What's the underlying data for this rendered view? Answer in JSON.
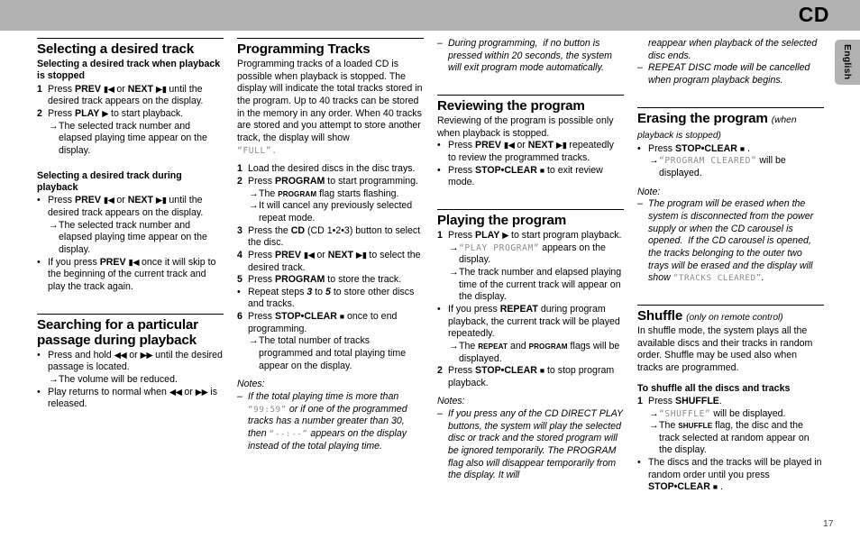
{
  "header": {
    "title": "CD",
    "language_tab": "English"
  },
  "page_number": "17",
  "columns": [
    {
      "id": "col-1",
      "blocks": [
        {
          "type": "rule"
        },
        {
          "type": "title",
          "text": "Selecting a desired track"
        },
        {
          "type": "subtitle",
          "text": "Selecting a desired track when playback is stopped"
        },
        {
          "type": "numrow",
          "marker": "1",
          "html": "Press <b>PREV</b> <span class=\"gly\">&#9646;&#9664;</span> or <b>NEXT</b> <span class=\"gly\">&#9654;&#9646;</span> until the desired track appears on the display."
        },
        {
          "type": "numrow",
          "marker": "2",
          "html": "Press <b>PLAY</b> <span class=\"gly\">&#9654;</span> to start playback."
        },
        {
          "type": "arrow",
          "html": "The selected track number and elapsed playing time appear on the display."
        },
        {
          "type": "spacer-md"
        },
        {
          "type": "subtitle",
          "text": "Selecting a desired track during playback"
        },
        {
          "type": "bullet",
          "html": "Press <b>PREV</b> <span class=\"gly\">&#9646;&#9664;</span> or <b>NEXT</b> <span class=\"gly\">&#9654;&#9646;</span> until the desired track appears on the display."
        },
        {
          "type": "arrow",
          "html": "The selected track number and elapsed playing time appear on the display."
        },
        {
          "type": "bullet",
          "html": "If you press <b>PREV</b> <span class=\"gly\">&#9646;&#9664;</span> once it will skip to the beginning of the current track and play the track again."
        },
        {
          "type": "spacer-lg"
        },
        {
          "type": "rule"
        },
        {
          "type": "title",
          "text": "Searching for a particular passage during playback"
        },
        {
          "type": "bullet",
          "html": "Press and hold <span class=\"gly\">&#9664;&#9664;</span> or <span class=\"gly\">&#9654;&#9654;</span> until the desired passage is located."
        },
        {
          "type": "arrow",
          "html": "The volume will be reduced."
        },
        {
          "type": "bullet",
          "html": "Play returns to normal when <span class=\"gly\">&#9664;&#9664;</span> or <span class=\"gly\">&#9654;&#9654;</span> is released."
        }
      ]
    },
    {
      "id": "col-2",
      "blocks": [
        {
          "type": "rule"
        },
        {
          "type": "title",
          "text": "Programming Tracks"
        },
        {
          "type": "para",
          "text": "Programming tracks of a loaded CD is possible when playback is stopped. The display will indicate the total tracks stored in the program. Up to 40 tracks can be stored in the memory in any order. When 40 tracks are stored and you attempt to store another track, the display will show"
        },
        {
          "type": "para-lcd",
          "pre": "",
          "lcd": "“FULL”.",
          "post": ""
        },
        {
          "type": "spacer-sm"
        },
        {
          "type": "numrow",
          "marker": "1",
          "html": "Load the desired discs in the disc trays."
        },
        {
          "type": "numrow",
          "marker": "2",
          "html": "Press <b>PROGRAM</b> to start programming."
        },
        {
          "type": "arrow",
          "html": "The <span class=\"flag\">PROGRAM</span> flag starts flashing."
        },
        {
          "type": "arrow",
          "html": "It will cancel any previously selected repeat mode."
        },
        {
          "type": "numrow",
          "marker": "3",
          "html": "Press the <b>CD</b> (CD 1&#8226;2&#8226;3) button to select the disc."
        },
        {
          "type": "numrow",
          "marker": "4",
          "html": "Press <b>PREV</b> <span class=\"gly\">&#9646;&#9664;</span> or <b>NEXT</b> <span class=\"gly\">&#9654;&#9646;</span> to select the desired track."
        },
        {
          "type": "numrow",
          "marker": "5",
          "html": "Press <b>PROGRAM</b> to store the track."
        },
        {
          "type": "bullet",
          "html": "Repeat steps <b><i>3</i></b> to <b><i>5</i></b> to store other discs and tracks."
        },
        {
          "type": "numrow",
          "marker": "6",
          "html": "Press <b>STOP&#8226;CLEAR</b> <span class=\"gly-sq\">&#9632;</span> once to end programming."
        },
        {
          "type": "arrow",
          "html": "The total number of tracks programmed and total playing time appear on the display."
        },
        {
          "type": "notes-label",
          "text": "Notes:"
        },
        {
          "type": "dash",
          "html": "If the total playing time is more than <span class=\"lcd-i\">“99:59”</span> or if one of the programmed tracks has a number greater than 30, then <span class=\"lcd-i\">“--:--”</span> appears on the display instead of the total playing time."
        }
      ]
    },
    {
      "id": "col-3",
      "blocks": [
        {
          "type": "dash",
          "html": "During programming,&nbsp; if no button is pressed within 20 seconds, the system will exit program mode automatically."
        },
        {
          "type": "spacer-lg"
        },
        {
          "type": "rule"
        },
        {
          "type": "title",
          "text": "Reviewing the program"
        },
        {
          "type": "para",
          "text": "Reviewing of the program is possible only when playback is stopped."
        },
        {
          "type": "bullet",
          "html": "Press <b>PREV</b> <span class=\"gly\">&#9646;&#9664;</span> or <b>NEXT</b> <span class=\"gly\">&#9654;&#9646;</span> repeatedly to review the programmed tracks."
        },
        {
          "type": "bullet",
          "html": "Press <b>STOP&#8226;CLEAR</b> <span class=\"gly-sq\">&#9632;</span> to exit review mode."
        },
        {
          "type": "spacer-lg"
        },
        {
          "type": "rule"
        },
        {
          "type": "title",
          "text": "Playing the program"
        },
        {
          "type": "numrow",
          "marker": "1",
          "html": "Press <b>PLAY</b> <span class=\"gly\">&#9654;</span> to start program playback."
        },
        {
          "type": "arrow",
          "html": "<span class=\"lcd\">“PLAY PROGRAM”</span> appears on the display."
        },
        {
          "type": "arrow",
          "html": "The track number and elapsed playing time of the current track will appear on the display."
        },
        {
          "type": "bullet",
          "html": "If you press <b>REPEAT</b> during program playback, the current track will be played repeatedly."
        },
        {
          "type": "arrow",
          "html": "The <span class=\"flag\">REPEAT</span> and <span class=\"flag\">PROGRAM</span> flags will be displayed."
        },
        {
          "type": "numrow",
          "marker": "2",
          "html": "Press <b>STOP&#8226;CLEAR</b> <span class=\"gly-sq\">&#9632;</span> to stop program playback."
        },
        {
          "type": "notes-label",
          "text": "Notes:"
        },
        {
          "type": "dash",
          "html": "If you press any of the CD DIRECT PLAY buttons, the system will play the selected disc or track and the stored program will be ignored temporarily. The PROGRAM flag also will disappear temporarily from the display. It will"
        }
      ]
    },
    {
      "id": "col-4",
      "blocks": [
        {
          "type": "contin",
          "html": "reappear when playback of the selected disc ends."
        },
        {
          "type": "dash",
          "html": "REPEAT DISC mode will be cancelled when program playback begins."
        },
        {
          "type": "spacer-lg"
        },
        {
          "type": "rule"
        },
        {
          "type": "title-qual",
          "text": "Erasing the program",
          "qual": "(when playback is stopped)"
        },
        {
          "type": "bullet",
          "html": "Press <b>STOP&#8226;CLEAR</b> <span class=\"gly-sq\">&#9632;</span> ."
        },
        {
          "type": "arrow",
          "html": "<span class=\"lcd\">“PROGRAM CLEARED”</span> will be displayed."
        },
        {
          "type": "notes-label",
          "text": "Note:"
        },
        {
          "type": "dash",
          "html": "The program will be erased when the system is disconnected from the power supply or when the CD carousel is opened.&nbsp; If the CD carousel is opened, the tracks belonging to the outer two trays will be erased and the display will show <span class=\"lcd-i\">“TRACKS CLEARED”</span>."
        },
        {
          "type": "spacer-lg"
        },
        {
          "type": "rule"
        },
        {
          "type": "title-qual",
          "text": "Shuffle",
          "qual": "(only on remote control)"
        },
        {
          "type": "para",
          "text": "In shuffle mode, the system plays all the available discs and their tracks in random order. Shuffle may be used also when tracks are programmed."
        },
        {
          "type": "spacer-sm"
        },
        {
          "type": "subtitle",
          "text": "To shuffle all the discs and tracks"
        },
        {
          "type": "numrow",
          "marker": "1",
          "html": "Press <b>SHUFFLE</b>."
        },
        {
          "type": "arrow",
          "html": "<span class=\"lcd\">“SHUFFLE”</span> will be displayed."
        },
        {
          "type": "arrow",
          "html": "The <span class=\"flag\">SHUFFLE</span> flag, the disc and the track selected at random appear on the display."
        },
        {
          "type": "bullet",
          "html": "The discs and the tracks will be played in random order until you press <b>STOP&#8226;CLEAR</b> <span class=\"gly-sq\">&#9632;</span> ."
        }
      ]
    }
  ]
}
